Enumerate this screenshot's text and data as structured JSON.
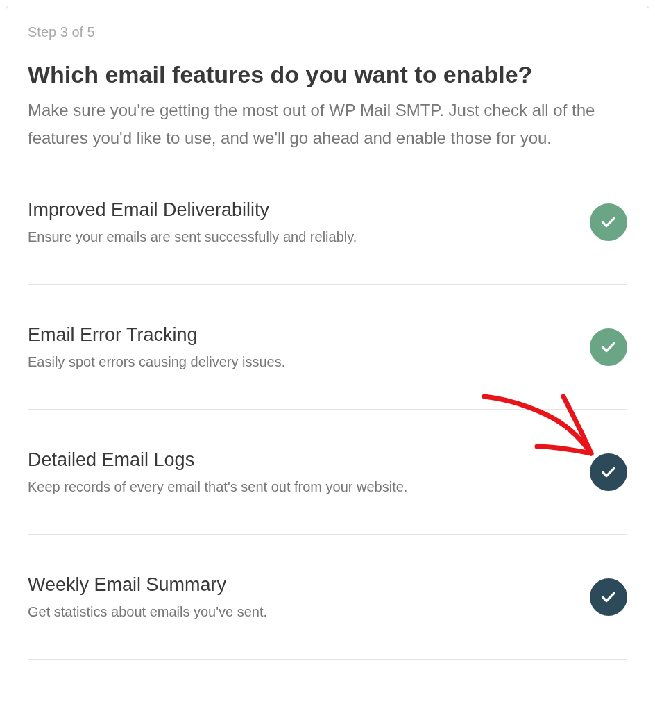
{
  "step": "Step 3 of 5",
  "heading": "Which email features do you want to enable?",
  "intro": "Make sure you're getting the most out of WP Mail SMTP. Just check all of the features you'd like to use, and we'll go ahead and enable those for you.",
  "features": [
    {
      "title": "Improved Email Deliverability",
      "description": "Ensure your emails are sent successfully and reliably.",
      "checked": true,
      "disabled": true
    },
    {
      "title": "Email Error Tracking",
      "description": "Easily spot errors causing delivery issues.",
      "checked": true,
      "disabled": true
    },
    {
      "title": "Detailed Email Logs",
      "description": "Keep records of every email that's sent out from your website.",
      "checked": true,
      "disabled": false
    },
    {
      "title": "Weekly Email Summary",
      "description": "Get statistics about emails you've sent.",
      "checked": true,
      "disabled": false
    }
  ]
}
